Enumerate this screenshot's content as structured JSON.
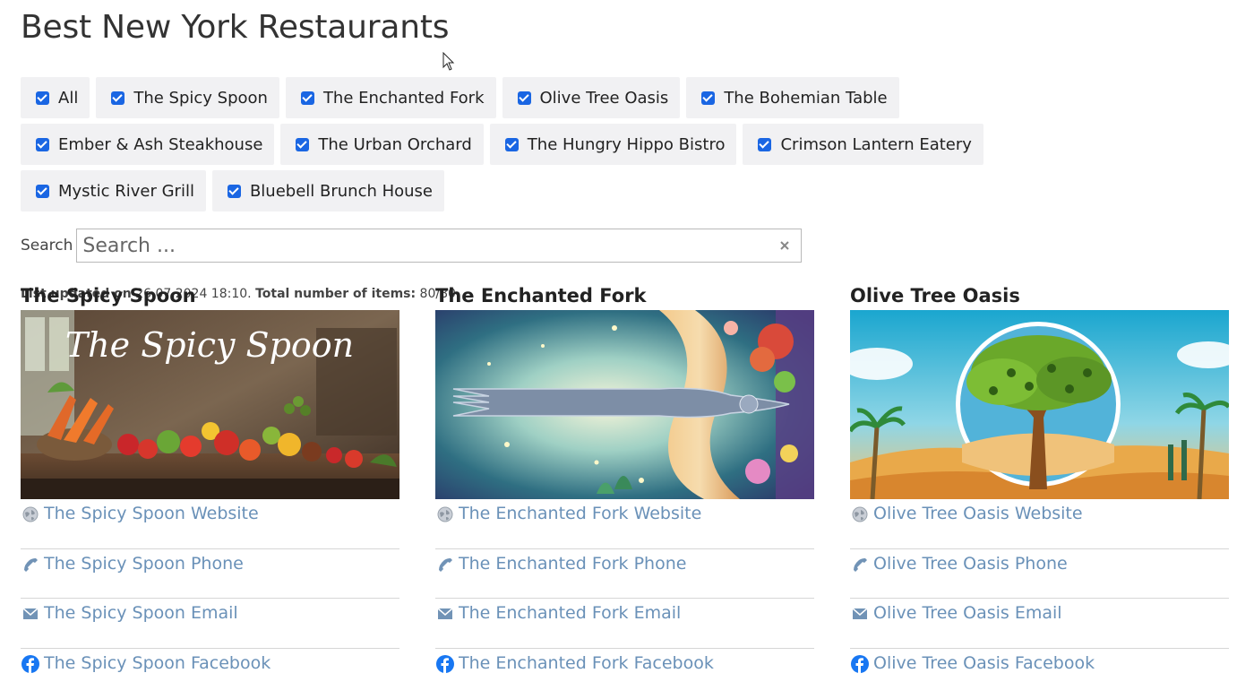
{
  "page": {
    "title": "Best New York Restaurants"
  },
  "filters": [
    {
      "label": "All",
      "checked": true
    },
    {
      "label": "The Spicy Spoon",
      "checked": true
    },
    {
      "label": "The Enchanted Fork",
      "checked": true
    },
    {
      "label": "Olive Tree Oasis",
      "checked": true
    },
    {
      "label": "The Bohemian Table",
      "checked": true
    },
    {
      "label": "Ember & Ash Steakhouse",
      "checked": true
    },
    {
      "label": "The Urban Orchard",
      "checked": true
    },
    {
      "label": "The Hungry Hippo Bistro",
      "checked": true
    },
    {
      "label": "Crimson Lantern Eatery",
      "checked": true
    },
    {
      "label": "Mystic River Grill",
      "checked": true
    },
    {
      "label": "Bluebell Brunch House",
      "checked": true
    }
  ],
  "search": {
    "label": "Search",
    "placeholder": "Search ...",
    "value": ""
  },
  "status": {
    "updated_label": "List updated on",
    "updated_value": "26.07.2024 18:10.",
    "total_label": "Total number of items:",
    "total_value": "80/80."
  },
  "colors": {
    "link": "#6a91b8",
    "checkbox": "#1a66e3",
    "filter_bg": "#f1f1f3"
  },
  "cards": [
    {
      "title": "The Spicy Spoon",
      "image_text": "The Spicy Spoon",
      "links": [
        {
          "icon": "globe-icon",
          "label": "The Spicy Spoon Website"
        },
        {
          "icon": "phone-icon",
          "label": "The Spicy Spoon Phone"
        },
        {
          "icon": "envelope-icon",
          "label": "The Spicy Spoon Email"
        },
        {
          "icon": "facebook-icon",
          "label": "The Spicy Spoon Facebook"
        }
      ]
    },
    {
      "title": "The Enchanted Fork",
      "links": [
        {
          "icon": "globe-icon",
          "label": "The Enchanted Fork Website"
        },
        {
          "icon": "phone-icon",
          "label": "The Enchanted Fork Phone"
        },
        {
          "icon": "envelope-icon",
          "label": "The Enchanted Fork Email"
        },
        {
          "icon": "facebook-icon",
          "label": "The Enchanted Fork Facebook"
        }
      ]
    },
    {
      "title": "Olive Tree Oasis",
      "links": [
        {
          "icon": "globe-icon",
          "label": "Olive Tree Oasis Website"
        },
        {
          "icon": "phone-icon",
          "label": "Olive Tree Oasis Phone"
        },
        {
          "icon": "envelope-icon",
          "label": "Olive Tree Oasis Email"
        },
        {
          "icon": "facebook-icon",
          "label": "Olive Tree Oasis Facebook"
        }
      ]
    }
  ]
}
